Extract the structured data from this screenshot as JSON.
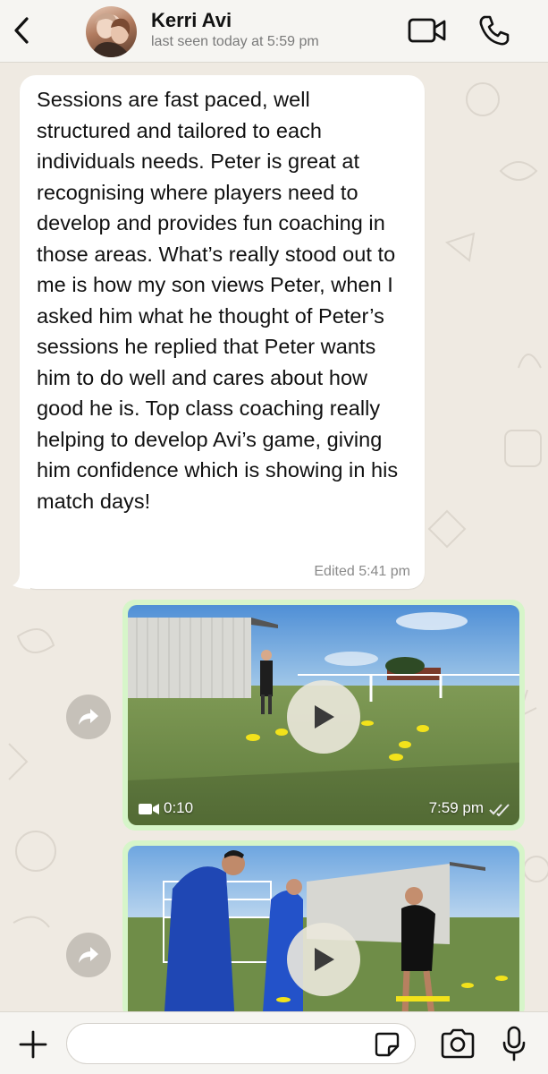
{
  "header": {
    "contact_name": "Kerri Avi",
    "last_seen": "last seen today at 5:59 pm",
    "icons": {
      "back": "chevron-left-icon",
      "video_call": "video-camera-icon",
      "voice_call": "phone-icon"
    }
  },
  "messages": [
    {
      "type": "text",
      "direction": "incoming",
      "text": "Sessions are fast paced, well structured and tailored to each individuals needs. Peter is great at recognising where players need to develop and provides fun coaching in those areas. What’s really stood out to me is how my son views Peter, when I asked him what he thought of Peter’s sessions he replied that Peter wants him to do well and cares about how good he is. Top class coaching really helping to develop Avi’s game, giving him confidence which is showing in his match days!",
      "meta": "Edited 5:41 pm"
    },
    {
      "type": "video",
      "direction": "outgoing",
      "duration": "0:10",
      "time": "7:59 pm",
      "status": "read"
    },
    {
      "type": "video",
      "direction": "outgoing",
      "duration": "",
      "time": "",
      "status": ""
    }
  ],
  "input_bar": {
    "placeholder": "",
    "icons": {
      "attach": "plus-icon",
      "sticker": "sticker-icon",
      "camera": "camera-icon",
      "mic": "microphone-icon"
    }
  },
  "colors": {
    "chat_background": "#efeae2",
    "incoming_bubble": "#ffffff",
    "outgoing_bubble": "#d6f5c9",
    "header_background": "#f6f5f2"
  }
}
